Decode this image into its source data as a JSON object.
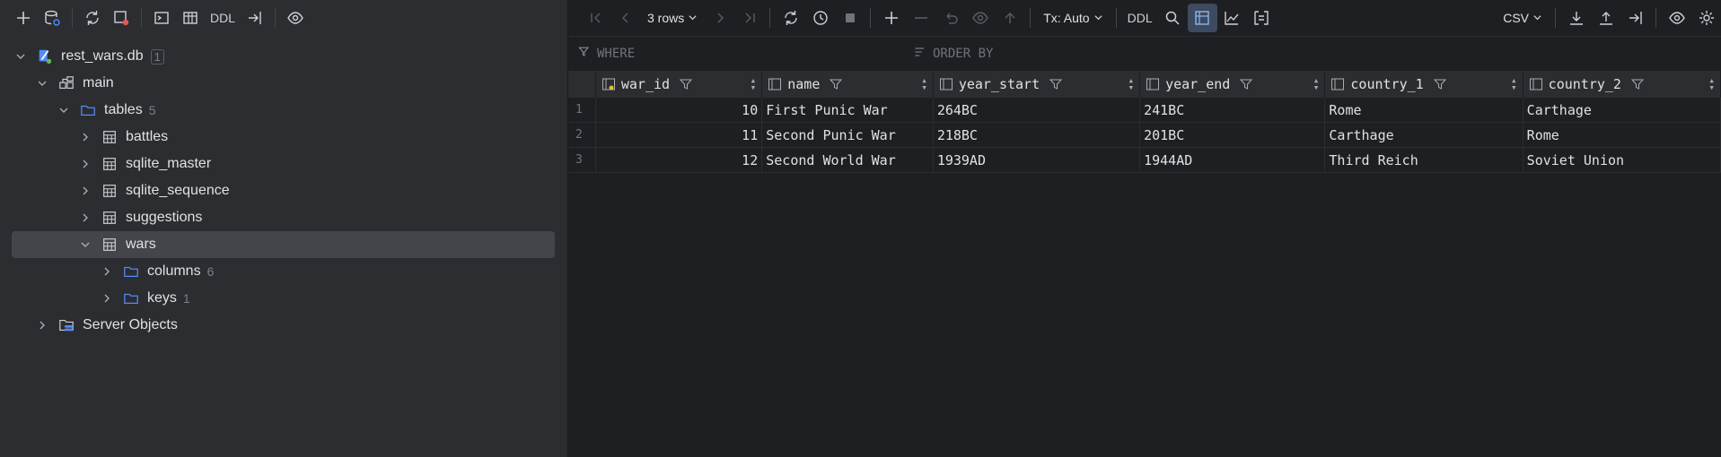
{
  "left_toolbar": {
    "ddl_label": "DDL"
  },
  "tree": {
    "db": {
      "label": "rest_wars.db",
      "count": "1"
    },
    "schema": {
      "label": "main"
    },
    "tables": {
      "label": "tables",
      "count": "5"
    },
    "items": [
      {
        "label": "battles"
      },
      {
        "label": "sqlite_master"
      },
      {
        "label": "sqlite_sequence"
      },
      {
        "label": "suggestions"
      },
      {
        "label": "wars"
      }
    ],
    "columns": {
      "label": "columns",
      "count": "6"
    },
    "keys": {
      "label": "keys",
      "count": "1"
    },
    "server": {
      "label": "Server Objects"
    }
  },
  "right_toolbar": {
    "rows_label": "3 rows",
    "tx_label": "Tx: Auto",
    "ddl_label": "DDL",
    "export_label": "CSV"
  },
  "filter": {
    "where": "WHERE",
    "order_by": "ORDER BY"
  },
  "grid": {
    "columns": [
      "war_id",
      "name",
      "year_start",
      "year_end",
      "country_1",
      "country_2"
    ],
    "rows": [
      {
        "n": "1",
        "war_id": "10",
        "name": "First Punic War",
        "year_start": "264BC",
        "year_end": "241BC",
        "country_1": "Rome",
        "country_2": "Carthage"
      },
      {
        "n": "2",
        "war_id": "11",
        "name": "Second Punic War",
        "year_start": "218BC",
        "year_end": "201BC",
        "country_1": "Carthage",
        "country_2": "Rome"
      },
      {
        "n": "3",
        "war_id": "12",
        "name": "Second World War",
        "year_start": "1939AD",
        "year_end": "1944AD",
        "country_1": "Third Reich",
        "country_2": "Soviet Union"
      }
    ]
  },
  "colors": {
    "accent": "#548af7",
    "folder": "#548af7",
    "selection": "#43454a"
  }
}
